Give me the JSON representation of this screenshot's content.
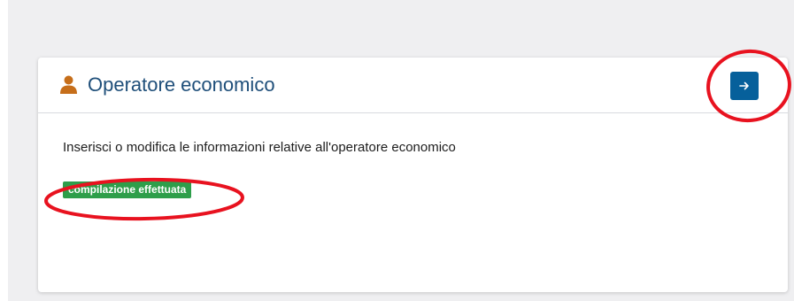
{
  "card": {
    "title": "Operatore economico",
    "description": "Inserisci o modifica le informazioni relative all'operatore economico",
    "status_badge": "compilazione effettuata",
    "icon": "user-icon",
    "action_icon": "arrow-right-icon"
  },
  "colors": {
    "page_background": "#efeff1",
    "title": "#1f4f7a",
    "user_icon": "#c66e1a",
    "button": "#06609b",
    "badge": "#2e9e4a",
    "annotation": "#e8121f"
  }
}
